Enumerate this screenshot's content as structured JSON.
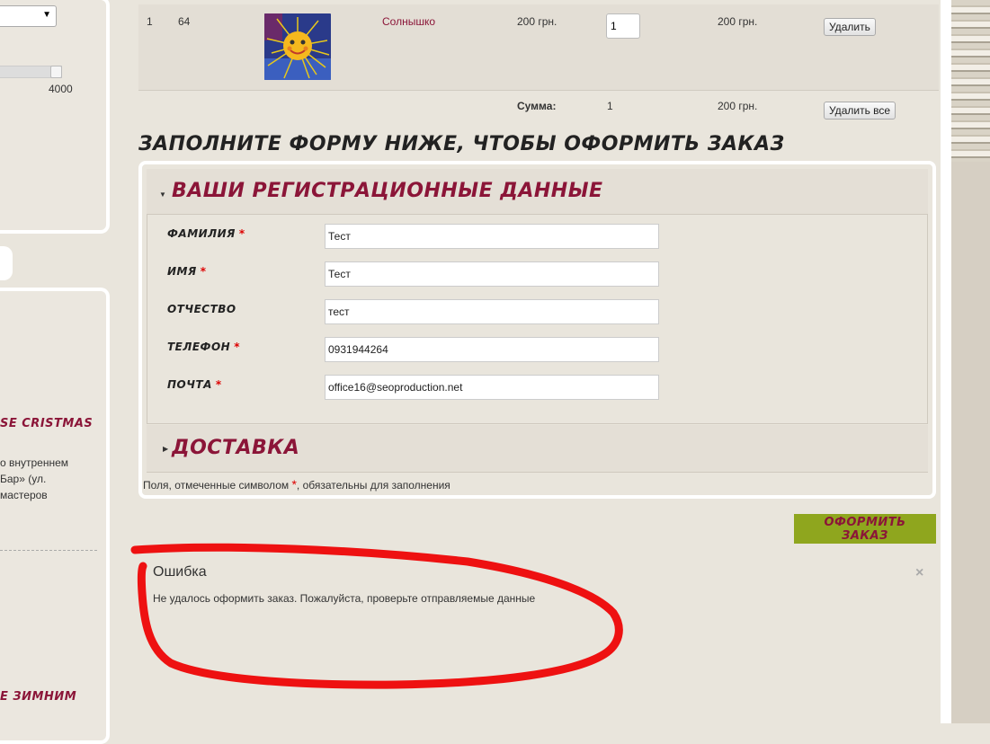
{
  "sidebar": {
    "price_max": "4000",
    "news_title": "SE CRISTMAS",
    "news_text": "о внутреннем Бар» (ул. мастеров",
    "news_title_2": "Е ЗИМНИМ",
    "select_arrow": "▼"
  },
  "cart": {
    "item": {
      "num": "1",
      "code": "64",
      "name": "Солнышко",
      "price": "200 грн.",
      "qty": "1",
      "total": "200 грн.",
      "delete_label": "Удалить"
    },
    "sum_label": "Сумма:",
    "sum_qty": "1",
    "sum_total": "200 грн.",
    "delete_all_label": "Удалить все"
  },
  "form": {
    "heading": "Заполните форму ниже, чтобы оформить заказ",
    "reg_section_title": "Ваши регистрационные данные",
    "fields": [
      {
        "label": "Фамилия",
        "required": "*",
        "value": "Тест"
      },
      {
        "label": "Имя",
        "required": "*",
        "value": "Тест"
      },
      {
        "label": "Отчество",
        "required": "",
        "value": "тест"
      },
      {
        "label": "Телефон",
        "required": "*",
        "value": "0931944264"
      },
      {
        "label": "Почта",
        "required": "*",
        "value": "office16@seoproduction.net"
      }
    ],
    "delivery_title": "Доставка",
    "note_before": "Поля, отмеченные символом ",
    "note_star": "*",
    "note_after": ", обязательны для заполнения",
    "submit_label": "Оформить заказ"
  },
  "error": {
    "title": "Ошибка",
    "message": "Не удалось оформить заказ. Пожалуйста, проверьте отправляемые данные",
    "close": "×"
  },
  "colors": {
    "accent": "#8b1538",
    "submit_bg": "#8fa61e",
    "annotation": "#ee1111"
  }
}
